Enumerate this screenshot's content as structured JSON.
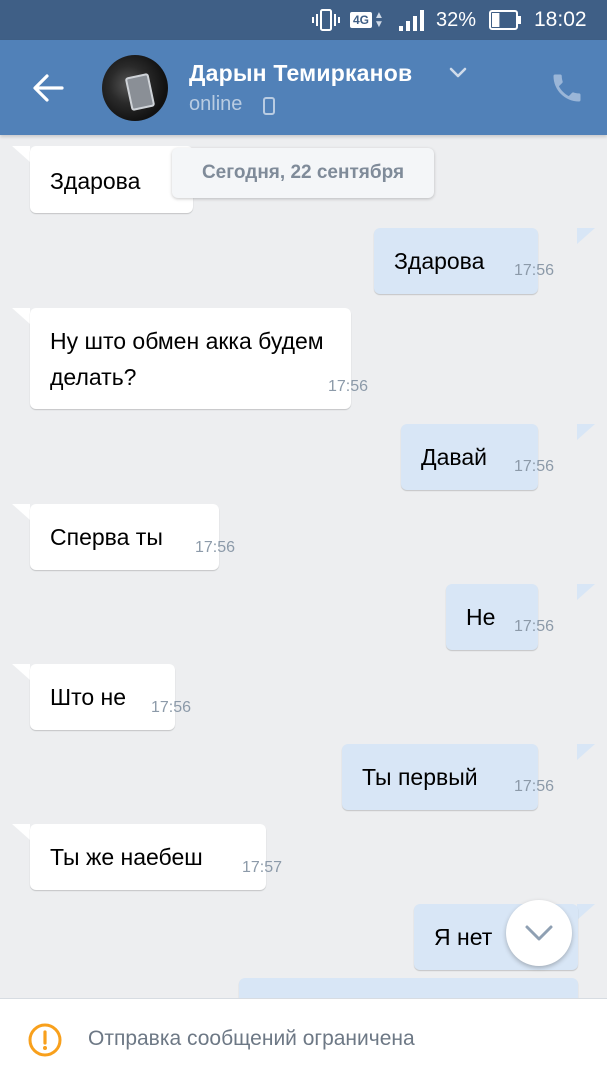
{
  "status_bar": {
    "network": "4G",
    "battery_percent": "32%",
    "battery_level": 0.32,
    "time": "18:02",
    "icons": [
      "vibrate-icon",
      "network-4g-icon",
      "signal-icon",
      "battery-icon"
    ]
  },
  "header": {
    "contact_name": "Дарын Темирканов",
    "status": "online",
    "icons": [
      "back-arrow-icon",
      "avatar",
      "chevron-down-icon",
      "mobile-phone-icon",
      "phone-call-icon"
    ]
  },
  "date_separator": "Сегодня, 22 сентября",
  "messages": [
    {
      "direction": "in",
      "text": "Здарова",
      "time": ""
    },
    {
      "direction": "out",
      "text": "Здарова",
      "time": "17:56"
    },
    {
      "direction": "in",
      "text_line1": "Ну што обмен акка будем",
      "text_line2": "делать?",
      "time": "17:56"
    },
    {
      "direction": "out",
      "text": "Давай",
      "time": "17:56"
    },
    {
      "direction": "in",
      "text": "Сперва ты",
      "time": "17:56"
    },
    {
      "direction": "out",
      "text": "Не",
      "time": "17:56"
    },
    {
      "direction": "in",
      "text": "Што не",
      "time": "17:56"
    },
    {
      "direction": "out",
      "text": "Ты первый",
      "time": "17:56"
    },
    {
      "direction": "in",
      "text": "Ты же наебеш",
      "time": "17:57"
    },
    {
      "direction": "out",
      "text": "Я нет",
      "time": ""
    }
  ],
  "footer": {
    "notice": "Отправка сообщений ограничена",
    "icon": "warning-icon"
  },
  "colors": {
    "header": "#5181b8",
    "status_bar": "#3f5f86",
    "background": "#edeef0",
    "incoming_bubble": "#ffffff",
    "outgoing_bubble": "#d8e6f6",
    "warning": "#f8a01c"
  }
}
